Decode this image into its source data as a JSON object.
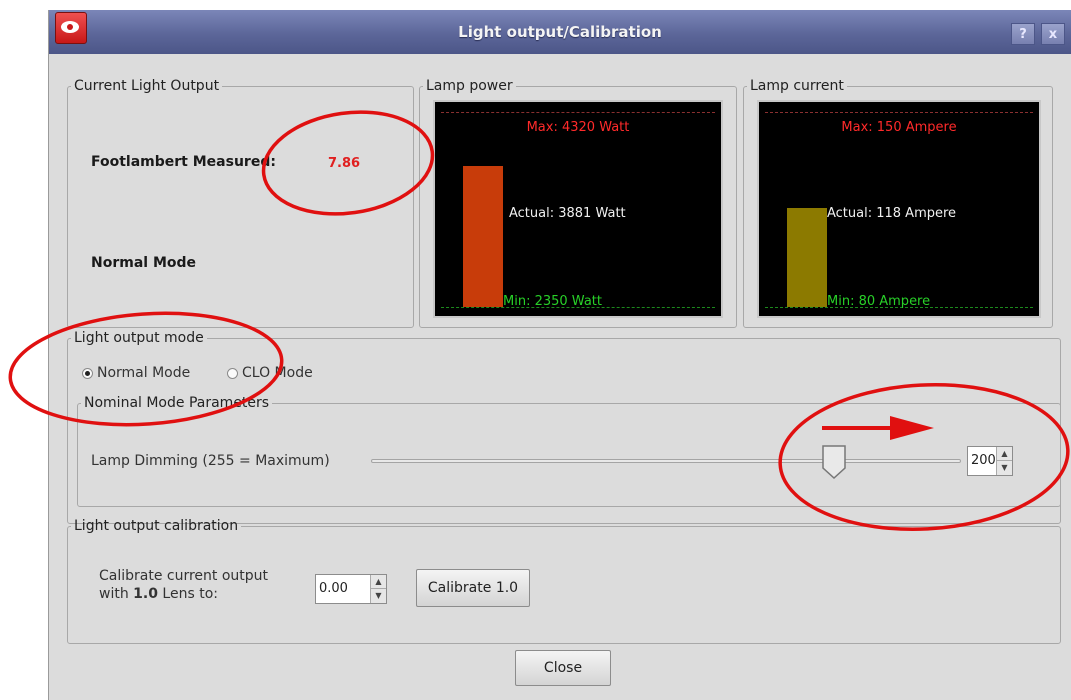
{
  "window": {
    "title": "Light output/Calibration",
    "help_label": "?",
    "close_label": "x"
  },
  "current_light_output": {
    "legend": "Current Light Output",
    "footlambert_label": "Footlambert Measured:",
    "footlambert_value": "7.86",
    "mode_label": "Normal Mode"
  },
  "lamp_power": {
    "legend": "Lamp power",
    "max_text": "Max: 4320 Watt",
    "actual_text": "Actual: 3881 Watt",
    "min_text": "Min: 2350 Watt",
    "bar_color": "#c83c0a",
    "min": 2350,
    "max": 4320,
    "actual": 3881
  },
  "lamp_current": {
    "legend": "Lamp current",
    "max_text": "Max: 150 Ampere",
    "actual_text": "Actual: 118 Ampere",
    "min_text": "Min: 80 Ampere",
    "bar_color": "#8c7a00",
    "min": 80,
    "max": 150,
    "actual": 118
  },
  "light_output_mode": {
    "legend": "Light output mode",
    "options": [
      {
        "label": "Normal Mode",
        "selected": true
      },
      {
        "label": "CLO Mode",
        "selected": false
      }
    ]
  },
  "nominal_params": {
    "legend": "Nominal Mode Parameters",
    "dimming_label": "Lamp Dimming (255 = Maximum)",
    "dimming_value": "200",
    "dimming_max": 255
  },
  "calibration": {
    "legend": "Light output calibration",
    "label_line1": "Calibrate current output",
    "label_line2_prefix": "with ",
    "label_line2_bold": "1.0",
    "label_line2_suffix": " Lens to:",
    "value": "0.00",
    "button_label": "Calibrate 1.0"
  },
  "close_button_label": "Close",
  "annotation_color": "#e01010"
}
